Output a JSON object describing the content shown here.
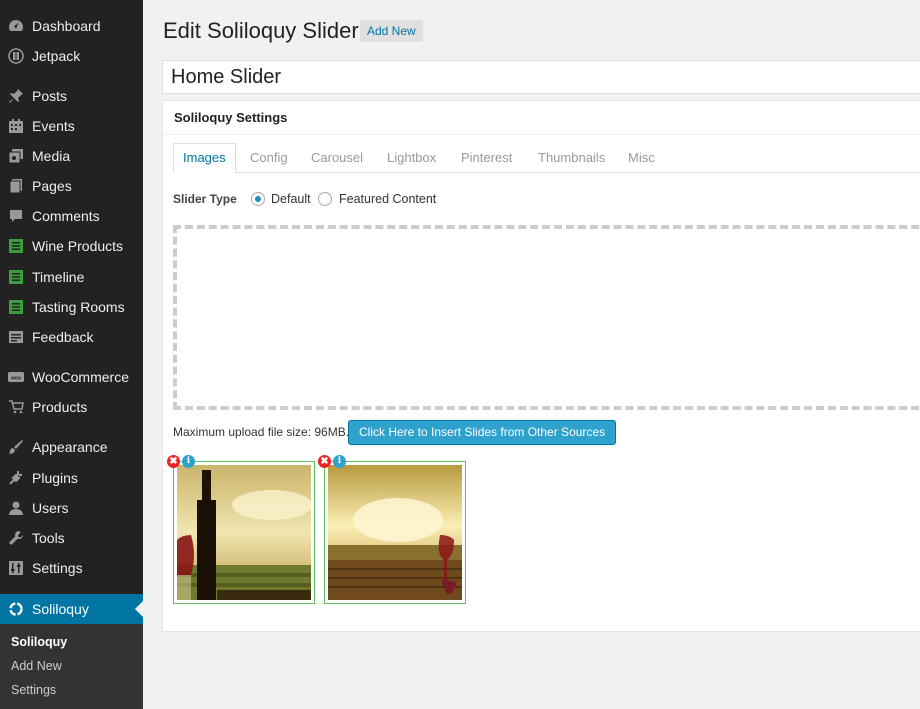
{
  "sidebar": {
    "items": [
      {
        "label": "Dashboard",
        "icon": "dashboard-icon"
      },
      {
        "label": "Jetpack",
        "icon": "jetpack-icon"
      },
      {
        "label": "Posts",
        "icon": "pin-icon"
      },
      {
        "label": "Events",
        "icon": "calendar-icon"
      },
      {
        "label": "Media",
        "icon": "media-icon"
      },
      {
        "label": "Pages",
        "icon": "pages-icon"
      },
      {
        "label": "Comments",
        "icon": "comment-icon"
      },
      {
        "label": "Wine Products",
        "icon": "list-icon"
      },
      {
        "label": "Timeline",
        "icon": "list-icon"
      },
      {
        "label": "Tasting Rooms",
        "icon": "list-icon"
      },
      {
        "label": "Feedback",
        "icon": "feedback-icon"
      },
      {
        "label": "WooCommerce",
        "icon": "woo-icon"
      },
      {
        "label": "Products",
        "icon": "cart-icon"
      },
      {
        "label": "Appearance",
        "icon": "brush-icon"
      },
      {
        "label": "Plugins",
        "icon": "plug-icon"
      },
      {
        "label": "Users",
        "icon": "user-icon"
      },
      {
        "label": "Tools",
        "icon": "wrench-icon"
      },
      {
        "label": "Settings",
        "icon": "settings-icon"
      },
      {
        "label": "Soliloquy",
        "icon": "soliloquy-icon"
      }
    ],
    "submenu": [
      "Soliloquy",
      "Add New",
      "Settings"
    ]
  },
  "header": {
    "title": "Edit Soliloquy Slider",
    "add_new": "Add New"
  },
  "post_title": "Home Slider",
  "settings": {
    "heading": "Soliloquy Settings",
    "tabs": [
      "Images",
      "Config",
      "Carousel",
      "Lightbox",
      "Pinterest",
      "Thumbnails",
      "Misc"
    ],
    "active_tab": "Images",
    "slider_type_label": "Slider Type",
    "slider_type_options": [
      "Default",
      "Featured Content"
    ],
    "slider_type_selected": "Default",
    "upload_info": "Maximum upload file size: 96MB.",
    "insert_button": "Click Here to Insert Slides from Other Sources",
    "remove_symbol": "✖",
    "info_symbol": "i"
  },
  "colors": {
    "sidebar_bg": "#222222",
    "accent": "#0074a2",
    "button_blue": "#2ea2cc",
    "slide_border": "#5fbf5f"
  }
}
